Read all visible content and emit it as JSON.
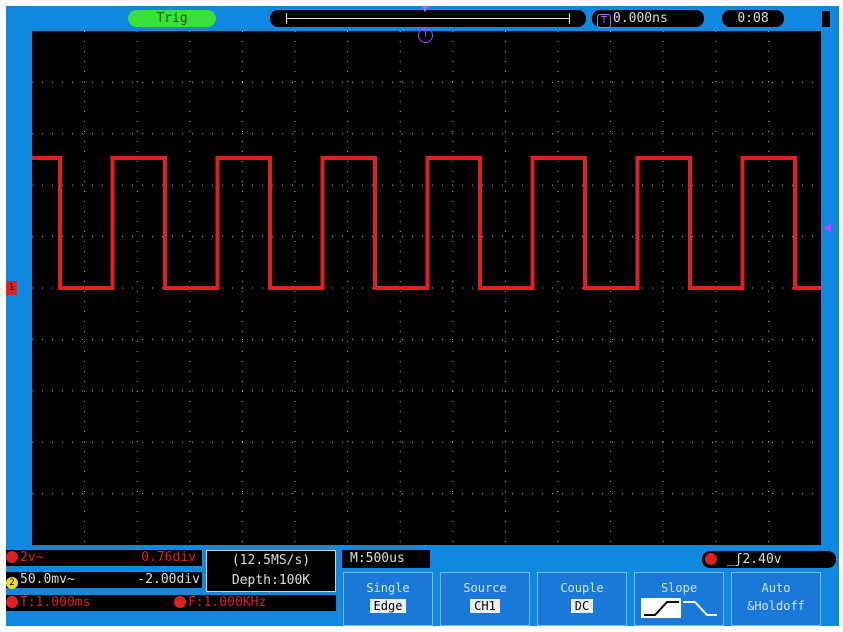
{
  "top_bar": {
    "trigger_status": "Trig",
    "trigger_position": "0.000ns",
    "time": "0:08"
  },
  "screen": {
    "ch1_marker": "1",
    "trigger_marker": "T",
    "colors": {
      "ch1": "#e02020",
      "grid": "#bbbbbb",
      "background": "#000000"
    }
  },
  "channels": {
    "ch1": {
      "volts_div": "2v~",
      "offset": "0.76div"
    },
    "ch2": {
      "volts_div": "50.0mv~",
      "offset": "-2.00div"
    }
  },
  "timebase": {
    "sample_rate": "(12.5MS/s)",
    "depth": "Depth:100K",
    "main": "M:500us"
  },
  "measurements": {
    "period": "T:1.000ms",
    "frequency": "F:1.000KHz"
  },
  "trigger_level": "2.40v",
  "menu": {
    "items": [
      {
        "title": "Single",
        "value": "Edge"
      },
      {
        "title": "Source",
        "value": "CH1"
      },
      {
        "title": "Couple",
        "value": "DC"
      },
      {
        "title": "Slope",
        "value": ""
      },
      {
        "title": "Auto",
        "value": "&Holdoff"
      }
    ]
  }
}
